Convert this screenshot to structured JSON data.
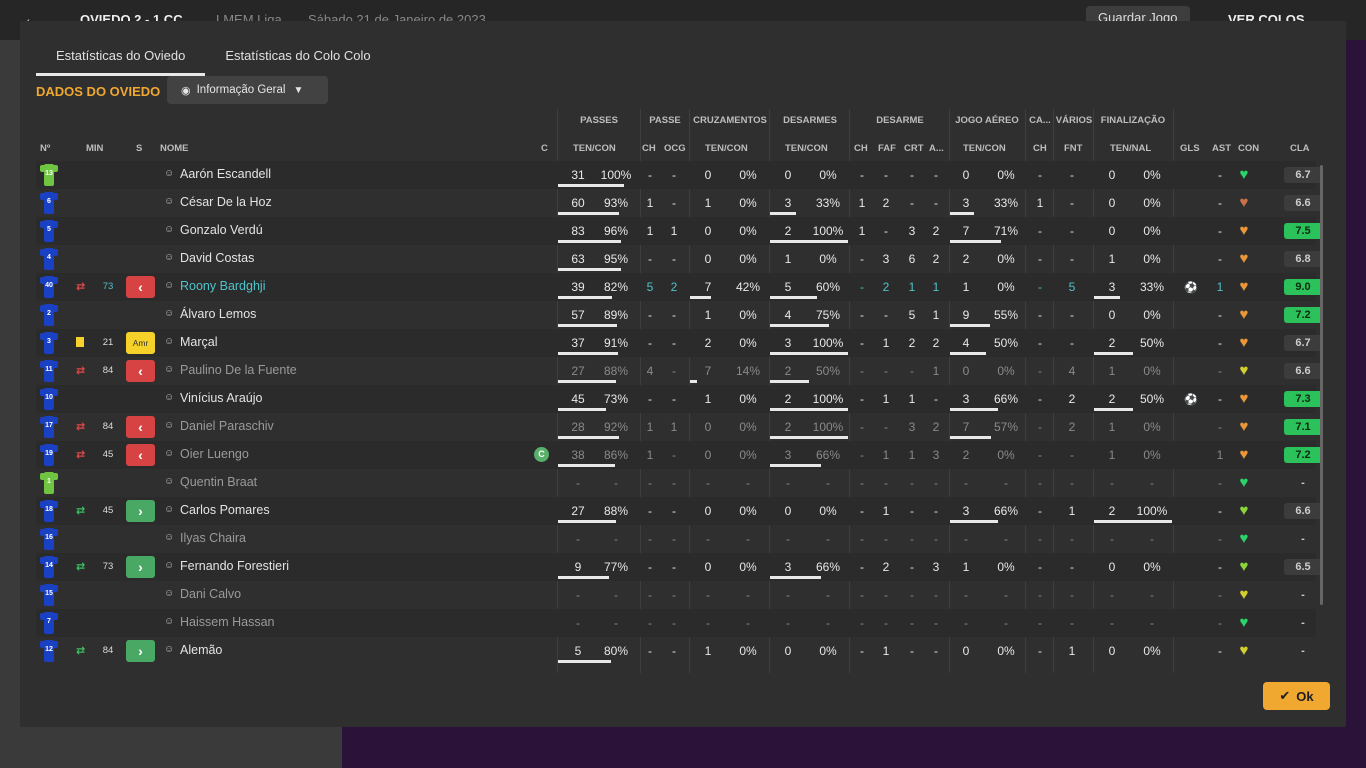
{
  "background": {
    "back_icon": "arrow-left-icon",
    "score": "OVIEDO  2 - 1  CC",
    "league": "LMEM Liga",
    "date": "Sábado 21 de Janeiro de 2023",
    "save_label": "Guardar Jogo",
    "see_label": "VER COLOS"
  },
  "tabs": [
    {
      "label": "Estatísticas do Oviedo",
      "active": true
    },
    {
      "label": "Estatísticas do Colo Colo",
      "active": false
    }
  ],
  "section_title": "DADOS DO OVIEDO",
  "view_select": {
    "label": "Informação Geral",
    "icon": "eye-icon"
  },
  "groups": {
    "passes": "PASSES",
    "passe": "PASSE",
    "cruz": "CRUZAMENTOS",
    "desarmes": "DESARMES",
    "desarme": "DESARME",
    "aereo": "JOGO AÉREO",
    "ca": "CA...",
    "varios": "VÁRIOS",
    "final": "FINALIZAÇÃO"
  },
  "columns": {
    "no": "Nº",
    "min": "MIN",
    "s": "S",
    "nome": "NOME",
    "c": "C",
    "pass_tc": "TEN/CON",
    "passe_ch": "CH",
    "passe_ocg": "OCG",
    "cruz_tc": "TEN/CON",
    "desarmes_tc": "TEN/CON",
    "des_ch": "CH",
    "des_faf": "FAF",
    "des_crt": "CRT",
    "des_a": "A...",
    "aereo_tc": "TEN/CON",
    "ca_ch": "CH",
    "var_fnt": "FNT",
    "fin_tn": "TEN/NAL",
    "gls": "GLS",
    "ast": "AST",
    "con": "CON",
    "cla": "CLA"
  },
  "players": [
    {
      "num": "13",
      "gk": true,
      "name": "Aarón Escandell",
      "pt": "31",
      "pp": "100%",
      "pf": 1.0,
      "pch": "-",
      "pocg": "-",
      "ct": "0",
      "cp": "0%",
      "cf": 0,
      "dt": "0",
      "dp": "0%",
      "df": 0,
      "dch": "-",
      "dfaf": "-",
      "dcrt": "-",
      "da": "-",
      "at": "0",
      "ap": "0%",
      "af": 0,
      "cach": "-",
      "fnt": "-",
      "ft": "0",
      "fp": "0%",
      "ff": 0,
      "gls": "",
      "ast": "-",
      "con": "green",
      "cla": "6.7",
      "clg": false
    },
    {
      "num": "6",
      "name": "César De la Hoz",
      "pt": "60",
      "pp": "93%",
      "pf": 0.93,
      "pch": "1",
      "pocg": "-",
      "ct": "1",
      "cp": "0%",
      "cf": 0,
      "dt": "3",
      "dp": "33%",
      "df": 0.33,
      "dch": "1",
      "dfaf": "2",
      "dcrt": "-",
      "da": "-",
      "at": "3",
      "ap": "33%",
      "af": 0.33,
      "cach": "1",
      "fnt": "-",
      "ft": "0",
      "fp": "0%",
      "ff": 0,
      "gls": "",
      "ast": "-",
      "con": "brown",
      "cla": "6.6",
      "clg": false
    },
    {
      "num": "5",
      "name": "Gonzalo Verdú",
      "pt": "83",
      "pp": "96%",
      "pf": 0.96,
      "pch": "1",
      "pocg": "1",
      "ct": "0",
      "cp": "0%",
      "cf": 0,
      "dt": "2",
      "dp": "100%",
      "df": 1.0,
      "dch": "1",
      "dfaf": "-",
      "dcrt": "3",
      "da": "2",
      "at": "7",
      "ap": "71%",
      "af": 0.71,
      "cach": "-",
      "fnt": "-",
      "ft": "0",
      "fp": "0%",
      "ff": 0,
      "gls": "",
      "ast": "-",
      "con": "orange",
      "cla": "7.5",
      "clg": true
    },
    {
      "num": "4",
      "name": "David Costas",
      "pt": "63",
      "pp": "95%",
      "pf": 0.95,
      "pch": "-",
      "pocg": "-",
      "ct": "0",
      "cp": "0%",
      "cf": 0,
      "dt": "1",
      "dp": "0%",
      "df": 0,
      "dch": "-",
      "dfaf": "3",
      "dcrt": "6",
      "da": "2",
      "at": "2",
      "ap": "0%",
      "af": 0,
      "cach": "-",
      "fnt": "-",
      "ft": "1",
      "fp": "0%",
      "ff": 0,
      "gls": "",
      "ast": "-",
      "con": "orange",
      "cla": "6.8",
      "clg": false
    },
    {
      "num": "40",
      "name": "Roony Bardghji",
      "hl": true,
      "sub": "out",
      "min": "73",
      "pt": "39",
      "pp": "82%",
      "pf": 0.82,
      "pch": "5",
      "pocg": "2",
      "ct": "7",
      "cp": "42%",
      "cf": 0.42,
      "dt": "5",
      "dp": "60%",
      "df": 0.6,
      "dch": "-",
      "dfaf": "2",
      "dcrt": "1",
      "da": "1",
      "at": "1",
      "ap": "0%",
      "af": 0,
      "cach": "-",
      "fnt": "5",
      "ft": "3",
      "fp": "33%",
      "ff": 0.33,
      "gls": "ball",
      "ast": "1",
      "con": "orange",
      "cla": "9.0",
      "clg": true
    },
    {
      "num": "2",
      "name": "Álvaro Lemos",
      "pt": "57",
      "pp": "89%",
      "pf": 0.89,
      "pch": "-",
      "pocg": "-",
      "ct": "1",
      "cp": "0%",
      "cf": 0,
      "dt": "4",
      "dp": "75%",
      "df": 0.75,
      "dch": "-",
      "dfaf": "-",
      "dcrt": "5",
      "da": "1",
      "at": "9",
      "ap": "55%",
      "af": 0.55,
      "cach": "-",
      "fnt": "-",
      "ft": "0",
      "fp": "0%",
      "ff": 0,
      "gls": "",
      "ast": "-",
      "con": "orange",
      "cla": "7.2",
      "clg": true
    },
    {
      "num": "3",
      "name": "Marçal",
      "card": true,
      "min": "21",
      "sbox": "Amr",
      "pt": "37",
      "pp": "91%",
      "pf": 0.91,
      "pch": "-",
      "pocg": "-",
      "ct": "2",
      "cp": "0%",
      "cf": 0,
      "dt": "3",
      "dp": "100%",
      "df": 1.0,
      "dch": "-",
      "dfaf": "1",
      "dcrt": "2",
      "da": "2",
      "at": "4",
      "ap": "50%",
      "af": 0.5,
      "cach": "-",
      "fnt": "-",
      "ft": "2",
      "fp": "50%",
      "ff": 0.5,
      "gls": "",
      "ast": "-",
      "con": "orange",
      "cla": "6.7",
      "clg": false
    },
    {
      "num": "11",
      "name": "Paulino De la Fuente",
      "dim": true,
      "sub": "out",
      "min": "84",
      "pt": "27",
      "pp": "88%",
      "pf": 0.88,
      "pch": "4",
      "pocg": "-",
      "ct": "7",
      "cp": "14%",
      "cf": 0.14,
      "dt": "2",
      "dp": "50%",
      "df": 0.5,
      "dch": "-",
      "dfaf": "-",
      "dcrt": "-",
      "da": "1",
      "at": "0",
      "ap": "0%",
      "af": 0,
      "cach": "-",
      "fnt": "4",
      "ft": "1",
      "fp": "0%",
      "ff": 0,
      "gls": "",
      "ast": "-",
      "con": "yellow",
      "cla": "6.6",
      "clg": false
    },
    {
      "num": "10",
      "name": "Vinícius Araújo",
      "pt": "45",
      "pp": "73%",
      "pf": 0.73,
      "pch": "-",
      "pocg": "-",
      "ct": "1",
      "cp": "0%",
      "cf": 0,
      "dt": "2",
      "dp": "100%",
      "df": 1.0,
      "dch": "-",
      "dfaf": "1",
      "dcrt": "1",
      "da": "-",
      "at": "3",
      "ap": "66%",
      "af": 0.66,
      "cach": "-",
      "fnt": "2",
      "ft": "2",
      "fp": "50%",
      "ff": 0.5,
      "gls": "ball",
      "ast": "-",
      "con": "orange",
      "cla": "7.3",
      "clg": true
    },
    {
      "num": "17",
      "name": "Daniel Paraschiv",
      "dim": true,
      "sub": "out",
      "min": "84",
      "pt": "28",
      "pp": "92%",
      "pf": 0.92,
      "pch": "1",
      "pocg": "1",
      "ct": "0",
      "cp": "0%",
      "cf": 0,
      "dt": "2",
      "dp": "100%",
      "df": 1.0,
      "dch": "-",
      "dfaf": "-",
      "dcrt": "3",
      "da": "2",
      "at": "7",
      "ap": "57%",
      "af": 0.57,
      "cach": "-",
      "fnt": "2",
      "ft": "1",
      "fp": "0%",
      "ff": 0,
      "gls": "",
      "ast": "-",
      "con": "orange",
      "cla": "7.1",
      "clg": true
    },
    {
      "num": "19",
      "name": "Oier Luengo",
      "dim": true,
      "sub": "out",
      "min": "45",
      "capt": "C",
      "pt": "38",
      "pp": "86%",
      "pf": 0.86,
      "pch": "1",
      "pocg": "-",
      "ct": "0",
      "cp": "0%",
      "cf": 0,
      "dt": "3",
      "dp": "66%",
      "df": 0.66,
      "dch": "-",
      "dfaf": "1",
      "dcrt": "1",
      "da": "3",
      "at": "2",
      "ap": "0%",
      "af": 0,
      "cach": "-",
      "fnt": "-",
      "ft": "1",
      "fp": "0%",
      "ff": 0,
      "gls": "",
      "ast": "1",
      "con": "orange",
      "cla": "7.2",
      "clg": true
    },
    {
      "num": "1",
      "gk": true,
      "name": "Quentin Braat",
      "dim": true,
      "pt": "-",
      "pp": "-",
      "pf": 0,
      "pch": "-",
      "pocg": "-",
      "ct": "-",
      "cp": "-",
      "cf": 0,
      "dt": "-",
      "dp": "-",
      "df": 0,
      "dch": "-",
      "dfaf": "-",
      "dcrt": "-",
      "da": "-",
      "at": "-",
      "ap": "-",
      "af": 0,
      "cach": "-",
      "fnt": "-",
      "ft": "-",
      "fp": "-",
      "ff": 0,
      "gls": "",
      "ast": "-",
      "con": "green",
      "cla": "-",
      "clg": false
    },
    {
      "num": "18",
      "name": "Carlos Pomares",
      "sub": "in",
      "min": "45",
      "pt": "27",
      "pp": "88%",
      "pf": 0.88,
      "pch": "-",
      "pocg": "-",
      "ct": "0",
      "cp": "0%",
      "cf": 0,
      "dt": "0",
      "dp": "0%",
      "df": 0,
      "dch": "-",
      "dfaf": "1",
      "dcrt": "-",
      "da": "-",
      "at": "3",
      "ap": "66%",
      "af": 0.66,
      "cach": "-",
      "fnt": "1",
      "ft": "2",
      "fp": "100%",
      "ff": 1.0,
      "gls": "",
      "ast": "-",
      "con": "lime",
      "cla": "6.6",
      "clg": false
    },
    {
      "num": "16",
      "name": "Ilyas Chaira",
      "dim": true,
      "pt": "-",
      "pp": "-",
      "pf": 0,
      "pch": "-",
      "pocg": "-",
      "ct": "-",
      "cp": "-",
      "cf": 0,
      "dt": "-",
      "dp": "-",
      "df": 0,
      "dch": "-",
      "dfaf": "-",
      "dcrt": "-",
      "da": "-",
      "at": "-",
      "ap": "-",
      "af": 0,
      "cach": "-",
      "fnt": "-",
      "ft": "-",
      "fp": "-",
      "ff": 0,
      "gls": "",
      "ast": "-",
      "con": "green",
      "cla": "-",
      "clg": false
    },
    {
      "num": "14",
      "name": "Fernando Forestieri",
      "sub": "in",
      "min": "73",
      "pt": "9",
      "pp": "77%",
      "pf": 0.77,
      "pch": "-",
      "pocg": "-",
      "ct": "0",
      "cp": "0%",
      "cf": 0,
      "dt": "3",
      "dp": "66%",
      "df": 0.66,
      "dch": "-",
      "dfaf": "2",
      "dcrt": "-",
      "da": "3",
      "at": "1",
      "ap": "0%",
      "af": 0,
      "cach": "-",
      "fnt": "-",
      "ft": "0",
      "fp": "0%",
      "ff": 0,
      "gls": "",
      "ast": "-",
      "con": "lime",
      "cla": "6.5",
      "clg": false
    },
    {
      "num": "15",
      "name": "Dani Calvo",
      "dim": true,
      "pt": "-",
      "pp": "-",
      "pf": 0,
      "pch": "-",
      "pocg": "-",
      "ct": "-",
      "cp": "-",
      "cf": 0,
      "dt": "-",
      "dp": "-",
      "df": 0,
      "dch": "-",
      "dfaf": "-",
      "dcrt": "-",
      "da": "-",
      "at": "-",
      "ap": "-",
      "af": 0,
      "cach": "-",
      "fnt": "-",
      "ft": "-",
      "fp": "-",
      "ff": 0,
      "gls": "",
      "ast": "-",
      "con": "yellow",
      "cla": "-",
      "clg": false
    },
    {
      "num": "7",
      "name": "Haissem Hassan",
      "dim": true,
      "pt": "-",
      "pp": "-",
      "pf": 0,
      "pch": "-",
      "pocg": "-",
      "ct": "-",
      "cp": "-",
      "cf": 0,
      "dt": "-",
      "dp": "-",
      "df": 0,
      "dch": "-",
      "dfaf": "-",
      "dcrt": "-",
      "da": "-",
      "at": "-",
      "ap": "-",
      "af": 0,
      "cach": "-",
      "fnt": "-",
      "ft": "-",
      "fp": "-",
      "ff": 0,
      "gls": "",
      "ast": "-",
      "con": "green",
      "cla": "-",
      "clg": false
    },
    {
      "num": "12",
      "name": "Alemão",
      "sub": "in",
      "min": "84",
      "pt": "5",
      "pp": "80%",
      "pf": 0.8,
      "pch": "-",
      "pocg": "-",
      "ct": "1",
      "cp": "0%",
      "cf": 0,
      "dt": "0",
      "dp": "0%",
      "df": 0,
      "dch": "-",
      "dfaf": "1",
      "dcrt": "-",
      "da": "-",
      "at": "0",
      "ap": "0%",
      "af": 0,
      "cach": "-",
      "fnt": "1",
      "ft": "0",
      "fp": "0%",
      "ff": 0,
      "gls": "",
      "ast": "-",
      "con": "yellow",
      "cla": "-",
      "clg": false
    }
  ],
  "colors": {
    "accent": "#f0a830",
    "highlight": "#4ec3c9",
    "sub_out": "#d74343",
    "sub_in": "#4aa865",
    "rating_good": "#2bc25b"
  },
  "ok_label": "Ok"
}
